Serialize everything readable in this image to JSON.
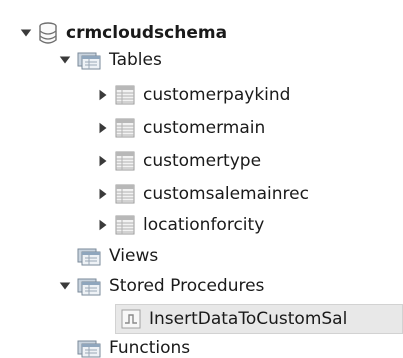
{
  "tree": {
    "schema": {
      "label": "crmcloudschema",
      "icon": "database-icon",
      "expanded": true
    },
    "tables_folder": {
      "label": "Tables",
      "icon": "folder-icon",
      "expanded": true
    },
    "tables": [
      {
        "label": "customerpaykind",
        "icon": "table-icon",
        "expanded": false
      },
      {
        "label": "customermain",
        "icon": "table-icon",
        "expanded": false
      },
      {
        "label": "customertype",
        "icon": "table-icon",
        "expanded": false
      },
      {
        "label": "customsalemainrec",
        "icon": "table-icon",
        "expanded": false
      },
      {
        "label": "locationforcity",
        "icon": "table-icon",
        "expanded": false
      }
    ],
    "views_folder": {
      "label": "Views",
      "icon": "folder-icon"
    },
    "procedures_folder": {
      "label": "Stored Procedures",
      "icon": "folder-icon",
      "expanded": true
    },
    "procedures": [
      {
        "label": "InsertDataToCustomSal",
        "icon": "stored-procedure-icon",
        "selected": true
      }
    ],
    "functions_folder": {
      "label": "Functions",
      "icon": "folder-icon"
    }
  },
  "colors": {
    "arrow": "#3a3a3a",
    "selected_bg": "#e8e8e8",
    "folder_icon": "#8fa6bd",
    "table_icon": "#a7a7a7"
  }
}
